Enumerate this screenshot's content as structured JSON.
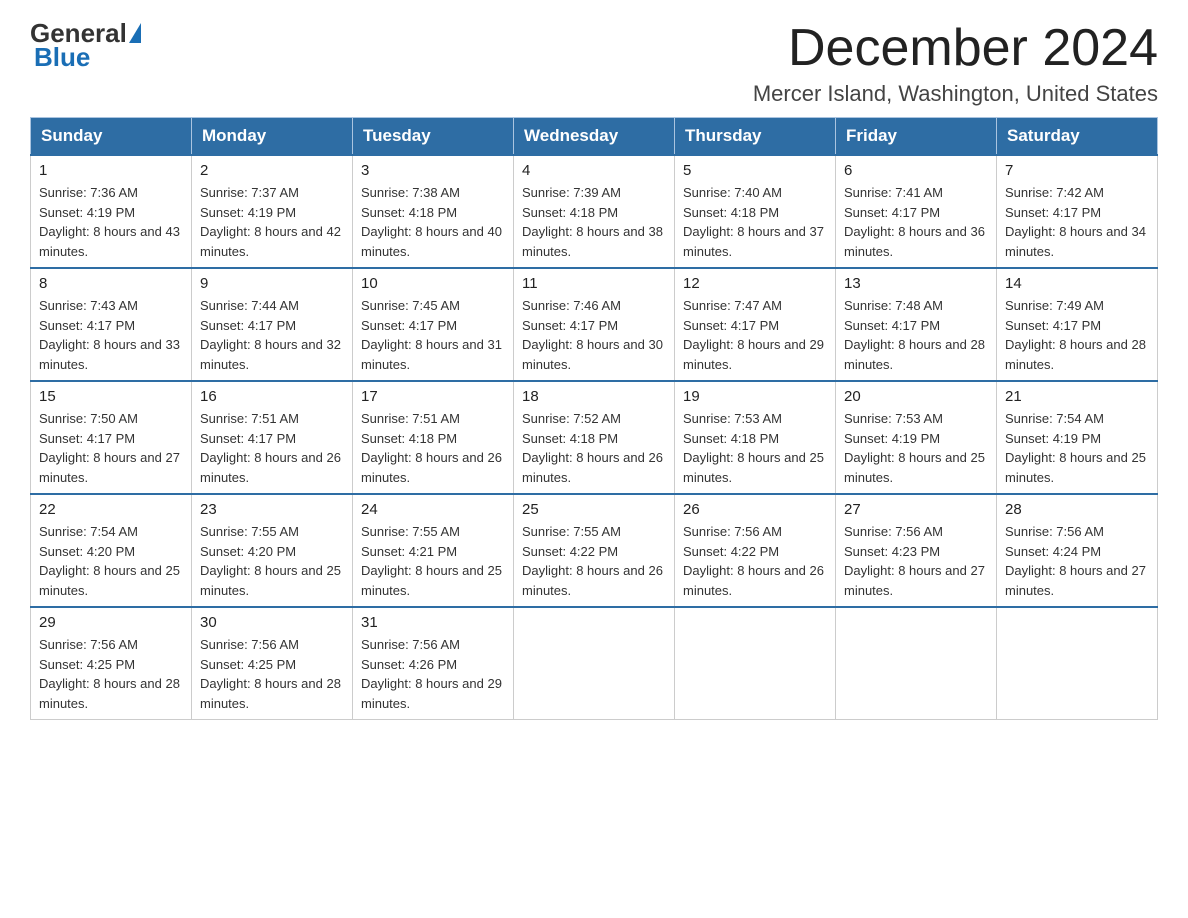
{
  "logo": {
    "general": "General",
    "blue": "Blue"
  },
  "title": {
    "month": "December 2024",
    "location": "Mercer Island, Washington, United States"
  },
  "weekdays": [
    "Sunday",
    "Monday",
    "Tuesday",
    "Wednesday",
    "Thursday",
    "Friday",
    "Saturday"
  ],
  "weeks": [
    [
      {
        "day": "1",
        "sunrise": "7:36 AM",
        "sunset": "4:19 PM",
        "daylight": "8 hours and 43 minutes."
      },
      {
        "day": "2",
        "sunrise": "7:37 AM",
        "sunset": "4:19 PM",
        "daylight": "8 hours and 42 minutes."
      },
      {
        "day": "3",
        "sunrise": "7:38 AM",
        "sunset": "4:18 PM",
        "daylight": "8 hours and 40 minutes."
      },
      {
        "day": "4",
        "sunrise": "7:39 AM",
        "sunset": "4:18 PM",
        "daylight": "8 hours and 38 minutes."
      },
      {
        "day": "5",
        "sunrise": "7:40 AM",
        "sunset": "4:18 PM",
        "daylight": "8 hours and 37 minutes."
      },
      {
        "day": "6",
        "sunrise": "7:41 AM",
        "sunset": "4:17 PM",
        "daylight": "8 hours and 36 minutes."
      },
      {
        "day": "7",
        "sunrise": "7:42 AM",
        "sunset": "4:17 PM",
        "daylight": "8 hours and 34 minutes."
      }
    ],
    [
      {
        "day": "8",
        "sunrise": "7:43 AM",
        "sunset": "4:17 PM",
        "daylight": "8 hours and 33 minutes."
      },
      {
        "day": "9",
        "sunrise": "7:44 AM",
        "sunset": "4:17 PM",
        "daylight": "8 hours and 32 minutes."
      },
      {
        "day": "10",
        "sunrise": "7:45 AM",
        "sunset": "4:17 PM",
        "daylight": "8 hours and 31 minutes."
      },
      {
        "day": "11",
        "sunrise": "7:46 AM",
        "sunset": "4:17 PM",
        "daylight": "8 hours and 30 minutes."
      },
      {
        "day": "12",
        "sunrise": "7:47 AM",
        "sunset": "4:17 PM",
        "daylight": "8 hours and 29 minutes."
      },
      {
        "day": "13",
        "sunrise": "7:48 AM",
        "sunset": "4:17 PM",
        "daylight": "8 hours and 28 minutes."
      },
      {
        "day": "14",
        "sunrise": "7:49 AM",
        "sunset": "4:17 PM",
        "daylight": "8 hours and 28 minutes."
      }
    ],
    [
      {
        "day": "15",
        "sunrise": "7:50 AM",
        "sunset": "4:17 PM",
        "daylight": "8 hours and 27 minutes."
      },
      {
        "day": "16",
        "sunrise": "7:51 AM",
        "sunset": "4:17 PM",
        "daylight": "8 hours and 26 minutes."
      },
      {
        "day": "17",
        "sunrise": "7:51 AM",
        "sunset": "4:18 PM",
        "daylight": "8 hours and 26 minutes."
      },
      {
        "day": "18",
        "sunrise": "7:52 AM",
        "sunset": "4:18 PM",
        "daylight": "8 hours and 26 minutes."
      },
      {
        "day": "19",
        "sunrise": "7:53 AM",
        "sunset": "4:18 PM",
        "daylight": "8 hours and 25 minutes."
      },
      {
        "day": "20",
        "sunrise": "7:53 AM",
        "sunset": "4:19 PM",
        "daylight": "8 hours and 25 minutes."
      },
      {
        "day": "21",
        "sunrise": "7:54 AM",
        "sunset": "4:19 PM",
        "daylight": "8 hours and 25 minutes."
      }
    ],
    [
      {
        "day": "22",
        "sunrise": "7:54 AM",
        "sunset": "4:20 PM",
        "daylight": "8 hours and 25 minutes."
      },
      {
        "day": "23",
        "sunrise": "7:55 AM",
        "sunset": "4:20 PM",
        "daylight": "8 hours and 25 minutes."
      },
      {
        "day": "24",
        "sunrise": "7:55 AM",
        "sunset": "4:21 PM",
        "daylight": "8 hours and 25 minutes."
      },
      {
        "day": "25",
        "sunrise": "7:55 AM",
        "sunset": "4:22 PM",
        "daylight": "8 hours and 26 minutes."
      },
      {
        "day": "26",
        "sunrise": "7:56 AM",
        "sunset": "4:22 PM",
        "daylight": "8 hours and 26 minutes."
      },
      {
        "day": "27",
        "sunrise": "7:56 AM",
        "sunset": "4:23 PM",
        "daylight": "8 hours and 27 minutes."
      },
      {
        "day": "28",
        "sunrise": "7:56 AM",
        "sunset": "4:24 PM",
        "daylight": "8 hours and 27 minutes."
      }
    ],
    [
      {
        "day": "29",
        "sunrise": "7:56 AM",
        "sunset": "4:25 PM",
        "daylight": "8 hours and 28 minutes."
      },
      {
        "day": "30",
        "sunrise": "7:56 AM",
        "sunset": "4:25 PM",
        "daylight": "8 hours and 28 minutes."
      },
      {
        "day": "31",
        "sunrise": "7:56 AM",
        "sunset": "4:26 PM",
        "daylight": "8 hours and 29 minutes."
      },
      null,
      null,
      null,
      null
    ]
  ]
}
